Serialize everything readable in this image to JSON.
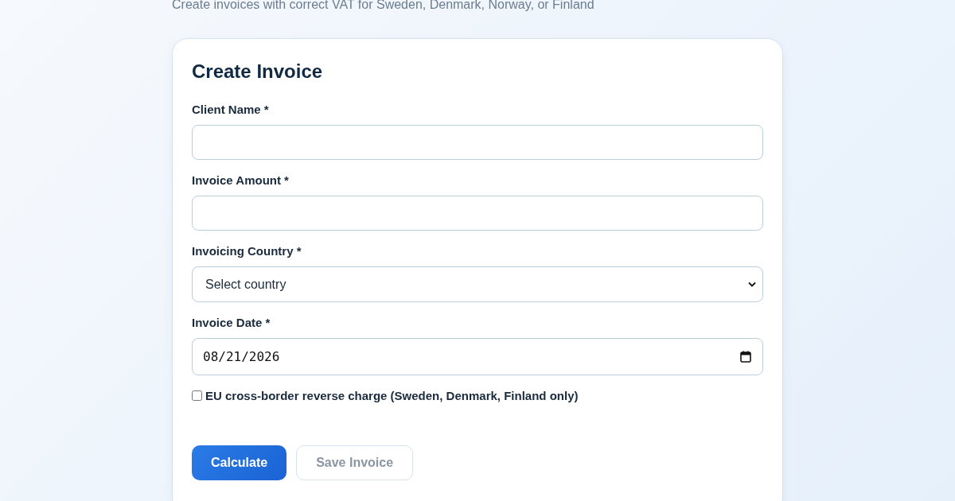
{
  "subtitle": "Create invoices with correct VAT for Sweden, Denmark, Norway, or Finland",
  "card": {
    "title": "Create Invoice",
    "fields": [
      {
        "kind": "text",
        "label": "Client Name *"
      },
      {
        "kind": "text",
        "label": "Invoice Amount *"
      },
      {
        "kind": "select",
        "label": "Invoicing Country *",
        "value": "Select country"
      },
      {
        "kind": "date",
        "label": "Invoice Date *",
        "value": "08/21/2026"
      }
    ],
    "reverse_charge": {
      "label": "EU cross-border reverse charge (Sweden, Denmark, Finland only)",
      "checked": false
    },
    "buttons": [
      {
        "label": "Calculate",
        "kind": "primary",
        "disabled": false
      },
      {
        "label": "Save Invoice",
        "kind": "secondary",
        "disabled": true
      }
    ]
  }
}
